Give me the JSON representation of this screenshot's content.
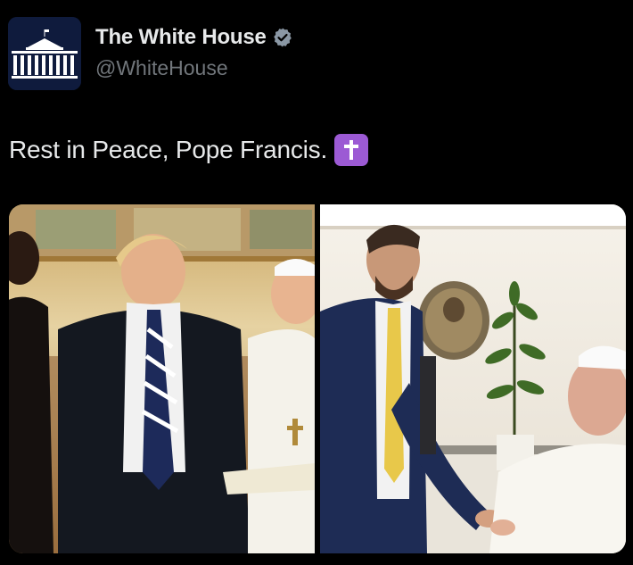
{
  "account": {
    "display_name": "The White House",
    "handle": "@WhiteHouse",
    "verified": true,
    "verified_badge_color": "#8b98a5"
  },
  "post": {
    "text": "Rest in Peace, Pope Francis.",
    "emoji": "latin-cross-emoji",
    "emoji_color": "#9c5ad4"
  },
  "media": {
    "images": [
      {
        "name": "photo-left",
        "icon": "photo-icon"
      },
      {
        "name": "photo-right",
        "icon": "photo-icon"
      }
    ]
  },
  "colors": {
    "background": "#000000",
    "text_primary": "#e7e9ea",
    "text_secondary": "#71767b"
  }
}
